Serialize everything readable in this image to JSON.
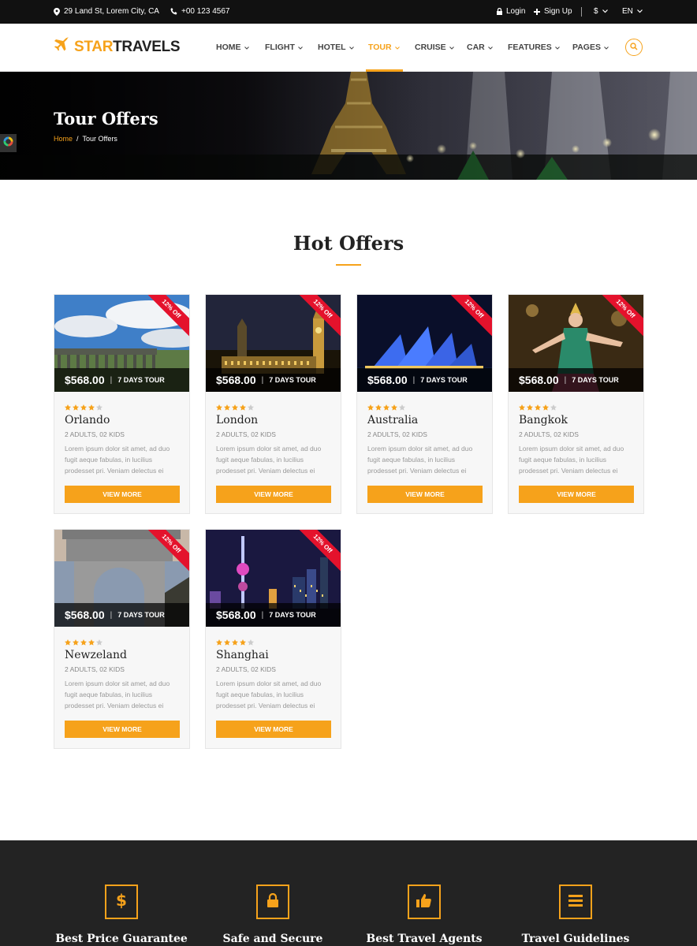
{
  "topbar": {
    "address": "29 Land St, Lorem City, CA",
    "phone": "+00 123 4567",
    "login": "Login",
    "signup": "Sign Up",
    "currency": "$",
    "language": "EN"
  },
  "brand": {
    "part1": "STAR",
    "part2": "TRAVELS"
  },
  "nav": [
    "HOME",
    "FLIGHT",
    "HOTEL",
    "TOUR",
    "CRUISE",
    "CAR",
    "FEATURES",
    "PAGES"
  ],
  "nav_active": "TOUR",
  "hero": {
    "title": "Tour Offers",
    "breadcrumb_home": "Home",
    "breadcrumb_sep": "/",
    "breadcrumb_current": "Tour Offers"
  },
  "section": {
    "title": "Hot Offers"
  },
  "cards": [
    {
      "city": "Orlando",
      "price": "$568.00",
      "days": "7 DAYS TOUR",
      "badge": "12% Off",
      "rating": 4,
      "meta": "2 ADULTS, 02 KIDS",
      "desc": "Lorem ipsum dolor sit amet, ad duo fugit aeque fabulas, in lucilius prodesset pri. Veniam delectus ei",
      "button": "VIEW MORE"
    },
    {
      "city": "London",
      "price": "$568.00",
      "days": "7 DAYS TOUR",
      "badge": "12% Off",
      "rating": 4,
      "meta": "2 ADULTS, 02 KIDS",
      "desc": "Lorem ipsum dolor sit amet, ad duo fugit aeque fabulas, in lucilius prodesset pri. Veniam delectus ei",
      "button": "VIEW MORE"
    },
    {
      "city": "Australia",
      "price": "$568.00",
      "days": "7 DAYS TOUR",
      "badge": "12% Off",
      "rating": 4,
      "meta": "2 ADULTS, 02 KIDS",
      "desc": "Lorem ipsum dolor sit amet, ad duo fugit aeque fabulas, in lucilius prodesset pri. Veniam delectus ei",
      "button": "VIEW MORE"
    },
    {
      "city": "Bangkok",
      "price": "$568.00",
      "days": "7 DAYS TOUR",
      "badge": "12% Off",
      "rating": 4,
      "meta": "2 ADULTS, 02 KIDS",
      "desc": "Lorem ipsum dolor sit amet, ad duo fugit aeque fabulas, in lucilius prodesset pri. Veniam delectus ei",
      "button": "VIEW MORE"
    },
    {
      "city": "Newzeland",
      "price": "$568.00",
      "days": "7 DAYS TOUR",
      "badge": "12% Off",
      "rating": 4,
      "meta": "2 ADULTS, 02 KIDS",
      "desc": "Lorem ipsum dolor sit amet, ad duo fugit aeque fabulas, in lucilius prodesset pri. Veniam delectus ei",
      "button": "VIEW MORE"
    },
    {
      "city": "Shanghai",
      "price": "$568.00",
      "days": "7 DAYS TOUR",
      "badge": "12% Off",
      "rating": 4,
      "meta": "2 ADULTS, 02 KIDS",
      "desc": "Lorem ipsum dolor sit amet, ad duo fugit aeque fabulas, in lucilius prodesset pri. Veniam delectus ei",
      "button": "VIEW MORE"
    }
  ],
  "features": [
    {
      "label": "Best Price Guarantee",
      "icon": "dollar-icon"
    },
    {
      "label": "Safe and Secure",
      "icon": "lock-icon"
    },
    {
      "label": "Best Travel Agents",
      "icon": "thumbs-up-icon"
    },
    {
      "label": "Travel Guidelines",
      "icon": "list-icon"
    }
  ],
  "colors": {
    "accent": "#f6a21b",
    "ribbon": "#e4122c",
    "dark": "#232323"
  }
}
